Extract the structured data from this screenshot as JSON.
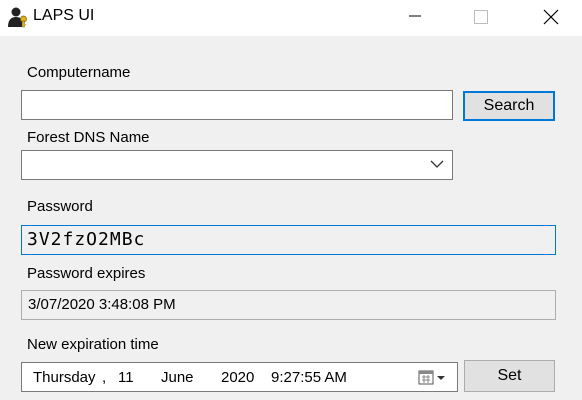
{
  "window": {
    "title": "LAPS UI",
    "icon": "user-key-icon",
    "controls": [
      "minimize-icon",
      "maximize-icon",
      "close-icon"
    ]
  },
  "form": {
    "computername_label": "Computername",
    "computername_value": "",
    "search_button": "Search",
    "forest_label": "Forest DNS Name",
    "forest_value": "",
    "password_label": "Password",
    "password_value": "3V2fzO2MBc",
    "expires_label": "Password expires",
    "expires_value": "3/07/2020 3:48:08 PM",
    "new_expiration_label": "New expiration time",
    "new_expiration": {
      "weekday": "Thursday",
      "comma": ",",
      "day": "11",
      "month": "June",
      "year": "2020",
      "time": "9:27:55 AM"
    },
    "set_button": "Set"
  },
  "colors": {
    "focus_blue": "#0078d7",
    "window_bg": "#f0f0f0",
    "button_bg": "#e1e1e1"
  }
}
